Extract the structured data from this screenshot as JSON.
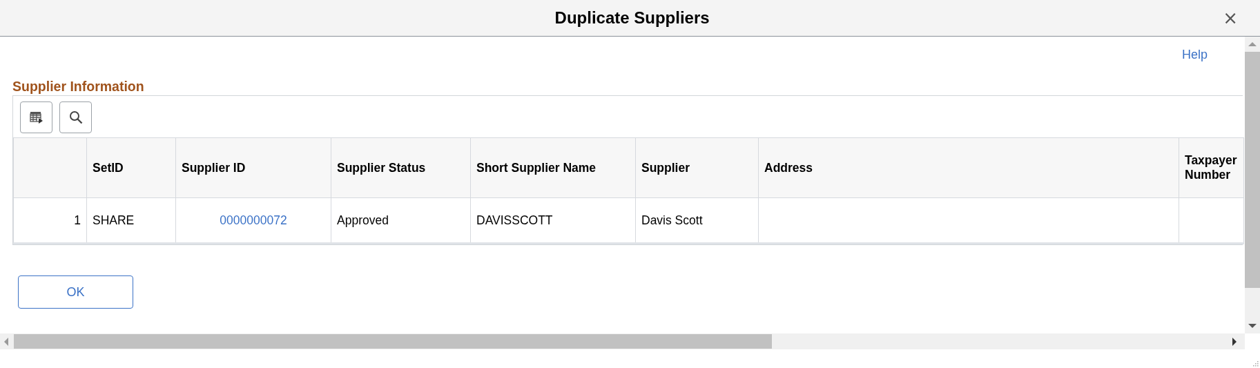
{
  "window": {
    "title": "Duplicate Suppliers",
    "close": "×"
  },
  "help_link": "Help",
  "section_title": "Supplier Information",
  "table": {
    "columns": [
      "SetID",
      "Supplier ID",
      "Supplier Status",
      "Short Supplier Name",
      "Supplier",
      "Address",
      "Taxpayer Number"
    ],
    "rows": [
      {
        "number": "1",
        "cells": [
          {
            "kind": "text",
            "text": "SHARE"
          },
          {
            "kind": "link",
            "text": "0000000072"
          },
          {
            "kind": "text",
            "text": "Approved"
          },
          {
            "kind": "text",
            "text": "DAVISSCOTT"
          },
          {
            "kind": "text",
            "text": "Davis Scott"
          }
        ]
      }
    ]
  },
  "buttons": [
    "OK"
  ]
}
